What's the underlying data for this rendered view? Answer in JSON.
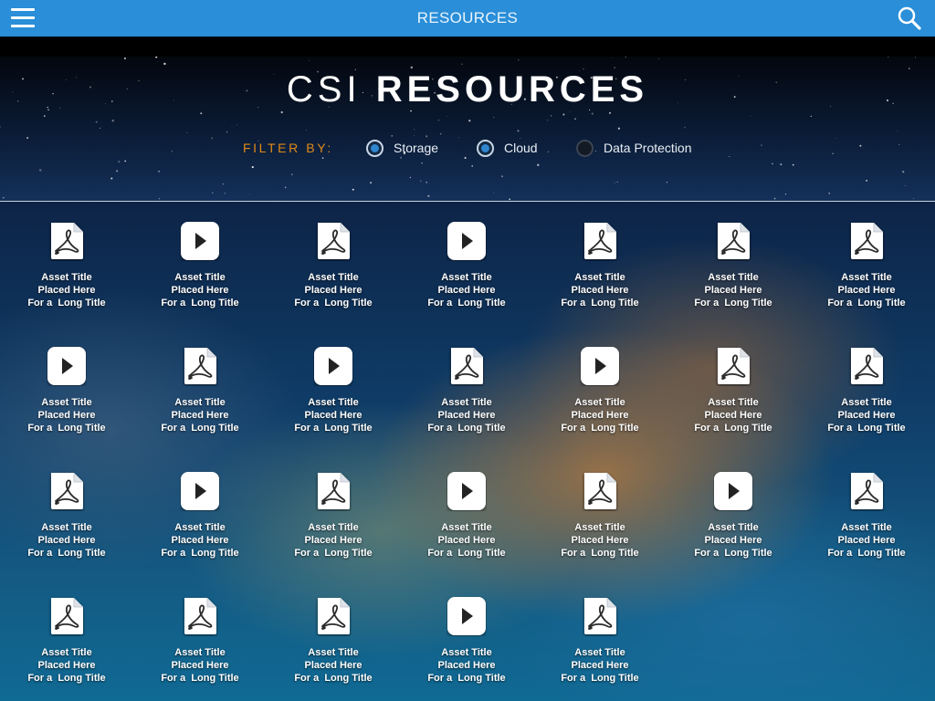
{
  "topbar": {
    "title": "RESOURCES",
    "menu_icon": "menu-icon",
    "search_icon": "search-icon",
    "color": "#2a8ed8"
  },
  "header": {
    "title_light": "CSI",
    "title_bold": "RESOURCES",
    "filter_label": "FILTER BY:",
    "filters": [
      {
        "label": "Storage",
        "selected": true
      },
      {
        "label": "Cloud",
        "selected": true
      },
      {
        "label": "Data Protection",
        "selected": false
      }
    ],
    "accent_color": "#e08a18"
  },
  "assets": [
    {
      "type": "pdf",
      "line1": "Asset Title",
      "line2": "Placed Here",
      "line3": "For a  Long Title"
    },
    {
      "type": "video",
      "line1": "Asset Title",
      "line2": "Placed Here",
      "line3": "For a  Long Title"
    },
    {
      "type": "pdf",
      "line1": "Asset Title",
      "line2": "Placed Here",
      "line3": "For a  Long Title"
    },
    {
      "type": "video",
      "line1": "Asset Title",
      "line2": "Placed Here",
      "line3": "For a  Long Title"
    },
    {
      "type": "pdf",
      "line1": "Asset Title",
      "line2": "Placed Here",
      "line3": "For a  Long Title"
    },
    {
      "type": "pdf",
      "line1": "Asset Title",
      "line2": "Placed Here",
      "line3": "For a  Long Title"
    },
    {
      "type": "pdf",
      "line1": "Asset Title",
      "line2": "Placed Here",
      "line3": "For a  Long Title"
    },
    {
      "type": "video",
      "line1": "Asset Title",
      "line2": "Placed Here",
      "line3": "For a  Long Title"
    },
    {
      "type": "pdf",
      "line1": "Asset Title",
      "line2": "Placed Here",
      "line3": "For a  Long Title"
    },
    {
      "type": "video",
      "line1": "Asset Title",
      "line2": "Placed Here",
      "line3": "For a  Long Title"
    },
    {
      "type": "pdf",
      "line1": "Asset Title",
      "line2": "Placed Here",
      "line3": "For a  Long Title"
    },
    {
      "type": "video",
      "line1": "Asset Title",
      "line2": "Placed Here",
      "line3": "For a  Long Title"
    },
    {
      "type": "pdf",
      "line1": "Asset Title",
      "line2": "Placed Here",
      "line3": "For a  Long Title"
    },
    {
      "type": "pdf",
      "line1": "Asset Title",
      "line2": "Placed Here",
      "line3": "For a  Long Title"
    },
    {
      "type": "pdf",
      "line1": "Asset Title",
      "line2": "Placed Here",
      "line3": "For a  Long Title"
    },
    {
      "type": "video",
      "line1": "Asset Title",
      "line2": "Placed Here",
      "line3": "For a  Long Title"
    },
    {
      "type": "pdf",
      "line1": "Asset Title",
      "line2": "Placed Here",
      "line3": "For a  Long Title"
    },
    {
      "type": "video",
      "line1": "Asset Title",
      "line2": "Placed Here",
      "line3": "For a  Long Title"
    },
    {
      "type": "pdf",
      "line1": "Asset Title",
      "line2": "Placed Here",
      "line3": "For a  Long Title"
    },
    {
      "type": "video",
      "line1": "Asset Title",
      "line2": "Placed Here",
      "line3": "For a  Long Title"
    },
    {
      "type": "pdf",
      "line1": "Asset Title",
      "line2": "Placed Here",
      "line3": "For a  Long Title"
    },
    {
      "type": "pdf",
      "line1": "Asset Title",
      "line2": "Placed Here",
      "line3": "For a  Long Title"
    },
    {
      "type": "pdf",
      "line1": "Asset Title",
      "line2": "Placed Here",
      "line3": "For a  Long Title"
    },
    {
      "type": "pdf",
      "line1": "Asset Title",
      "line2": "Placed Here",
      "line3": "For a  Long Title"
    },
    {
      "type": "video",
      "line1": "Asset Title",
      "line2": "Placed Here",
      "line3": "For a  Long Title"
    },
    {
      "type": "pdf",
      "line1": "Asset Title",
      "line2": "Placed Here",
      "line3": "For a  Long Title"
    }
  ]
}
